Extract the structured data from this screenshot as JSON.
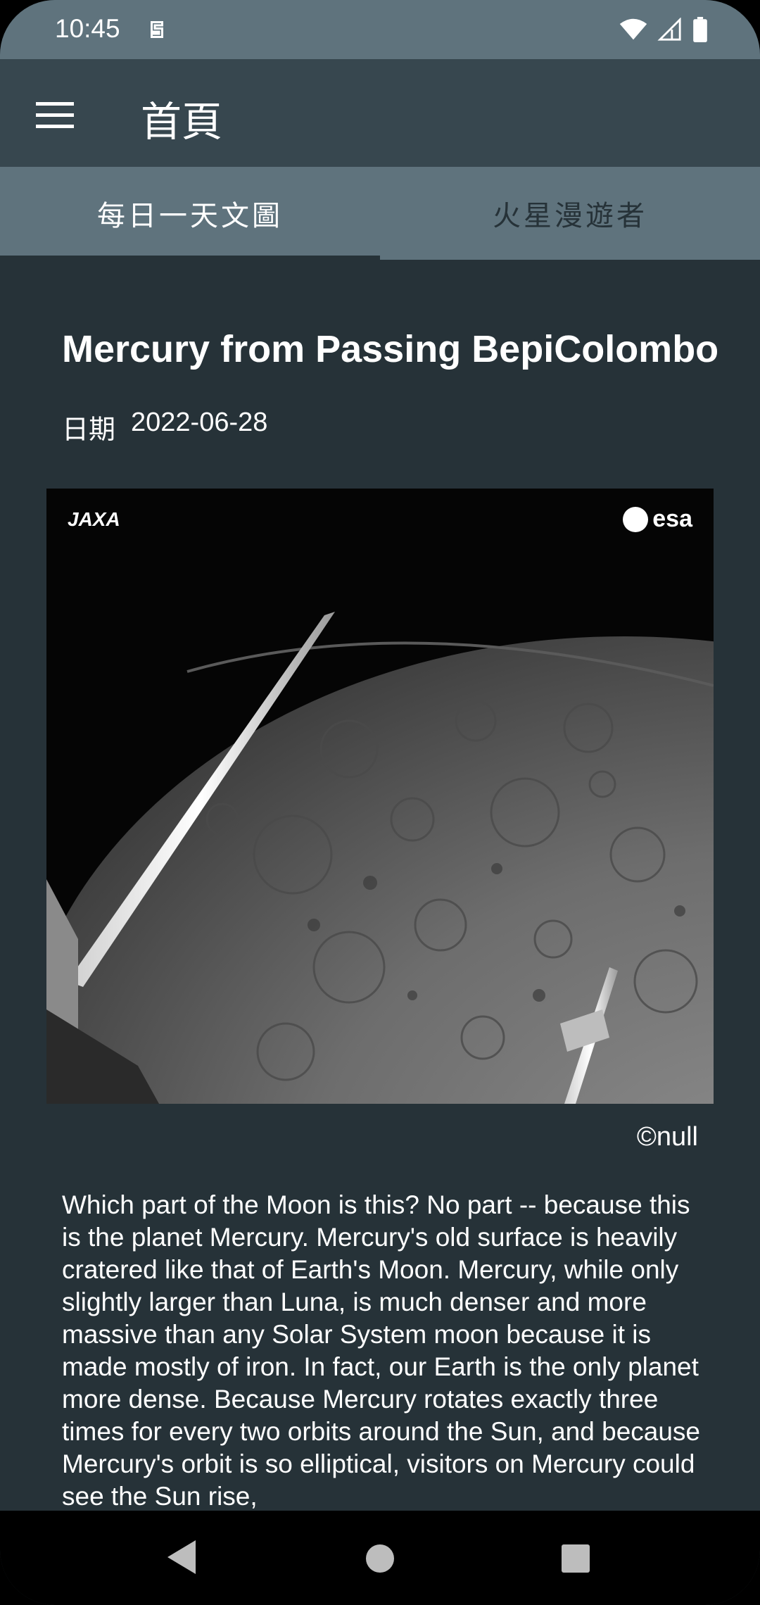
{
  "status_bar": {
    "time": "10:45",
    "icons": [
      "sim-icon",
      "wifi-icon",
      "signal-icon",
      "battery-icon"
    ]
  },
  "app_bar": {
    "title": "首頁",
    "menu_icon": "hamburger-menu-icon"
  },
  "tabs": [
    {
      "label": "每日一天文圖",
      "selected": true
    },
    {
      "label": "火星漫遊者",
      "selected": false
    }
  ],
  "article": {
    "title": "Mercury from Passing BepiColombo",
    "date_label": "日期",
    "date": "2022-06-28",
    "image_logos": {
      "left": "JAXA",
      "right": "esa"
    },
    "credit": "©null",
    "description": "Which part of the Moon is this?  No part -- because this is the planet Mercury.  Mercury's old surface is heavily cratered like that of Earth's Moon.  Mercury, while only slightly larger than Luna, is much denser and more massive than any Solar System moon because it is made mostly of iron.  In fact, our Earth is the only planet more dense.  Because Mercury rotates exactly three times for every two orbits around the Sun, and because Mercury's orbit is so elliptical, visitors on Mercury could see the Sun rise,"
  },
  "colors": {
    "status_bar": "#5f737d",
    "app_bar": "#37474f",
    "tabs_bg": "#5f737d",
    "background": "#263238"
  }
}
